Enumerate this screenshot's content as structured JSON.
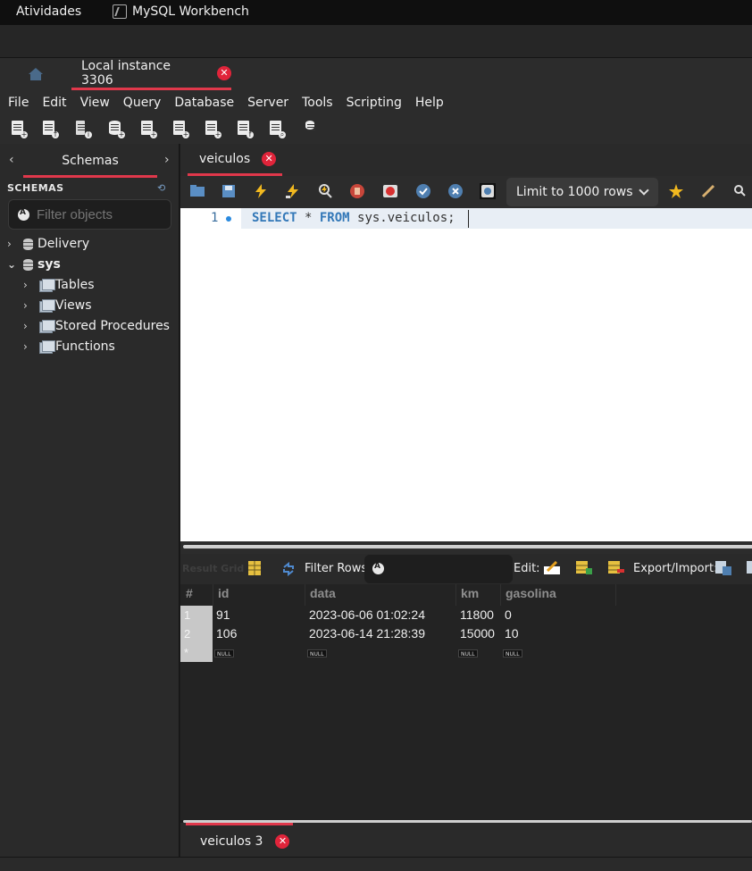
{
  "system": {
    "activities": "Atividades",
    "app_name": "MySQL Workbench"
  },
  "connection_tab": {
    "label": "Local instance 3306"
  },
  "menubar": {
    "items": [
      "File",
      "Edit",
      "View",
      "Query",
      "Database",
      "Server",
      "Tools",
      "Scripting",
      "Help"
    ]
  },
  "main_toolbar": {
    "icons": [
      "new-sql-tab-icon",
      "open-sql-script-icon",
      "open-inspector-icon",
      "create-schema-icon",
      "create-table-icon",
      "create-view-icon",
      "create-procedure-icon",
      "create-function-icon",
      "search-table-data-icon",
      "reconnect-icon"
    ]
  },
  "sidebar": {
    "tab_label": "Schemas",
    "section_title": "SCHEMAS",
    "filter_placeholder": "Filter objects",
    "schemas": [
      {
        "name": "Delivery",
        "expanded": false
      },
      {
        "name": "sys",
        "expanded": true,
        "children": [
          "Tables",
          "Views",
          "Stored Procedures",
          "Functions"
        ]
      }
    ]
  },
  "editor": {
    "tab_label": "veiculos",
    "limit_label": "Limit to 1000 rows",
    "line_number": "1",
    "sql_keyword1": "SELECT",
    "sql_mid": " * ",
    "sql_keyword2": "FROM",
    "sql_rest": " sys.veiculos;"
  },
  "result_toolbar": {
    "grid_label": "Result Grid",
    "filter_label": "Filter Rows:",
    "edit_label": "Edit:",
    "export_label": "Export/Import:"
  },
  "result_grid": {
    "columns": [
      "#",
      "id",
      "data",
      "km",
      "gasolina"
    ],
    "rows": [
      {
        "num": "1",
        "id": "91",
        "data": "2023-06-06 01:02:24",
        "km": "11800",
        "gasolina": "0"
      },
      {
        "num": "2",
        "id": "106",
        "data": "2023-06-14 21:28:39",
        "km": "15000",
        "gasolina": "10"
      }
    ],
    "new_row_marker": "*",
    "null_text": "NULL"
  },
  "result_tab": {
    "label": "veiculos 3"
  },
  "colors": {
    "accent": "#e0384b",
    "close": "#e0243a",
    "keyword": "#3378b8"
  }
}
